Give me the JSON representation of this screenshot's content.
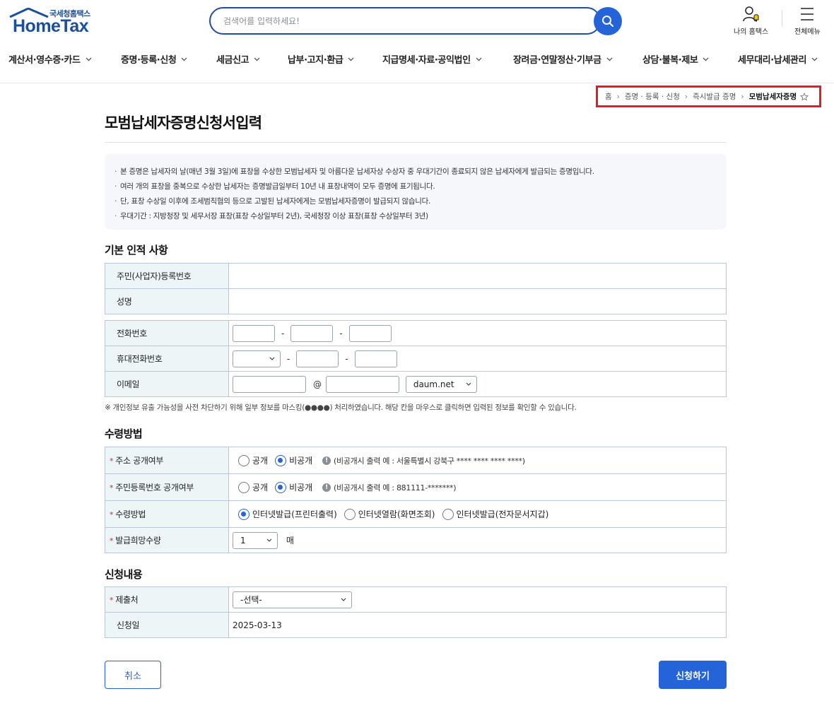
{
  "header": {
    "logo_sub": "국세청홈택스",
    "logo_main": "HomeTax",
    "search_placeholder": "검색어를 입력하세요!",
    "my_hometax": "나의 홈택스",
    "all_menu": "전체메뉴"
  },
  "gnb": [
    "계산서·영수증·카드",
    "증명·등록·신청",
    "세금신고",
    "납부·고지·환급",
    "지급명세·자료·공익법인",
    "장려금·연말정산·기부금",
    "상담·불복·제보",
    "세무대리·납세관리"
  ],
  "breadcrumb": {
    "home": "홈",
    "level1": "증명 · 등록 · 신청",
    "level2": "즉시발급 증명",
    "current": "모범납세자증명"
  },
  "page_title": "모범납세자증명신청서입력",
  "info_lines": [
    "본 증명은 납세자의 날(매년 3월 3일)에 표창을 수상한 모범납세자 및 아름다운 납세자상 수상자 중 우대기간이 종료되지 않은 납세자에게 발급되는 증명입니다.",
    "여러 개의 표창을 중복으로 수상한 납세자는 증명발급일부터 10년 내 표창내역이 모두 증명에 표기됩니다.",
    "단, 표창 수상일 이후에 조세범칙혐의 등으로 고발된 납세자에게는 모범납세자증명이 발급되지 않습니다.",
    "우대기간 : 지방청장 및 세무서장 표창(표창 수상일부터 2년), 국세청장 이상 표창(표창 수상일부터 3년)"
  ],
  "basic": {
    "section_title": "기본 인적 사항",
    "rrn_label": "주민(사업자)등록번호",
    "rrn_value": "",
    "name_label": "성명",
    "name_value": "",
    "phone_label": "전화번호",
    "mobile_label": "휴대전화번호",
    "email_label": "이메일",
    "email_at": "@",
    "email_domain": "daum.net",
    "dash": "-"
  },
  "privacy_note": "※ 개인정보 유출 가능성을 사전 차단하기 위해 일부 정보를 마스킹(●●●●) 처리하였습니다. 해당 칸을 마우스로 클릭하면 입력된 정보를 확인할 수 있습니다.",
  "receive": {
    "section_title": "수령방법",
    "addr_label": "주소 공개여부",
    "rrn_open_label": "주민등록번호 공개여부",
    "method_label": "수령방법",
    "qty_label": "발급희망수량",
    "open": "공개",
    "closed": "비공개",
    "addr_hint": "(비공개시 출력 예 : 서울특별시 강북구 **** **** **** ****)",
    "rrn_hint": "(비공개시 출력 예 : 881111-*******)",
    "method_opt1": "인터넷발급(프린터출력)",
    "method_opt2": "인터넷열람(화면조회)",
    "method_opt3": "인터넷발급(전자문서지갑)",
    "qty_value": "1",
    "qty_unit": "매"
  },
  "apply": {
    "section_title": "신청내용",
    "submit_to_label": "제출처",
    "submit_to_value": "-선택-",
    "date_label": "신청일",
    "date_value": "2025-03-13"
  },
  "buttons": {
    "cancel": "취소",
    "submit": "신청하기"
  },
  "colors": {
    "primary": "#2563d9",
    "brand": "#1a4f9c",
    "required": "#e11d2a",
    "highlight_border": "#e11d2a"
  }
}
